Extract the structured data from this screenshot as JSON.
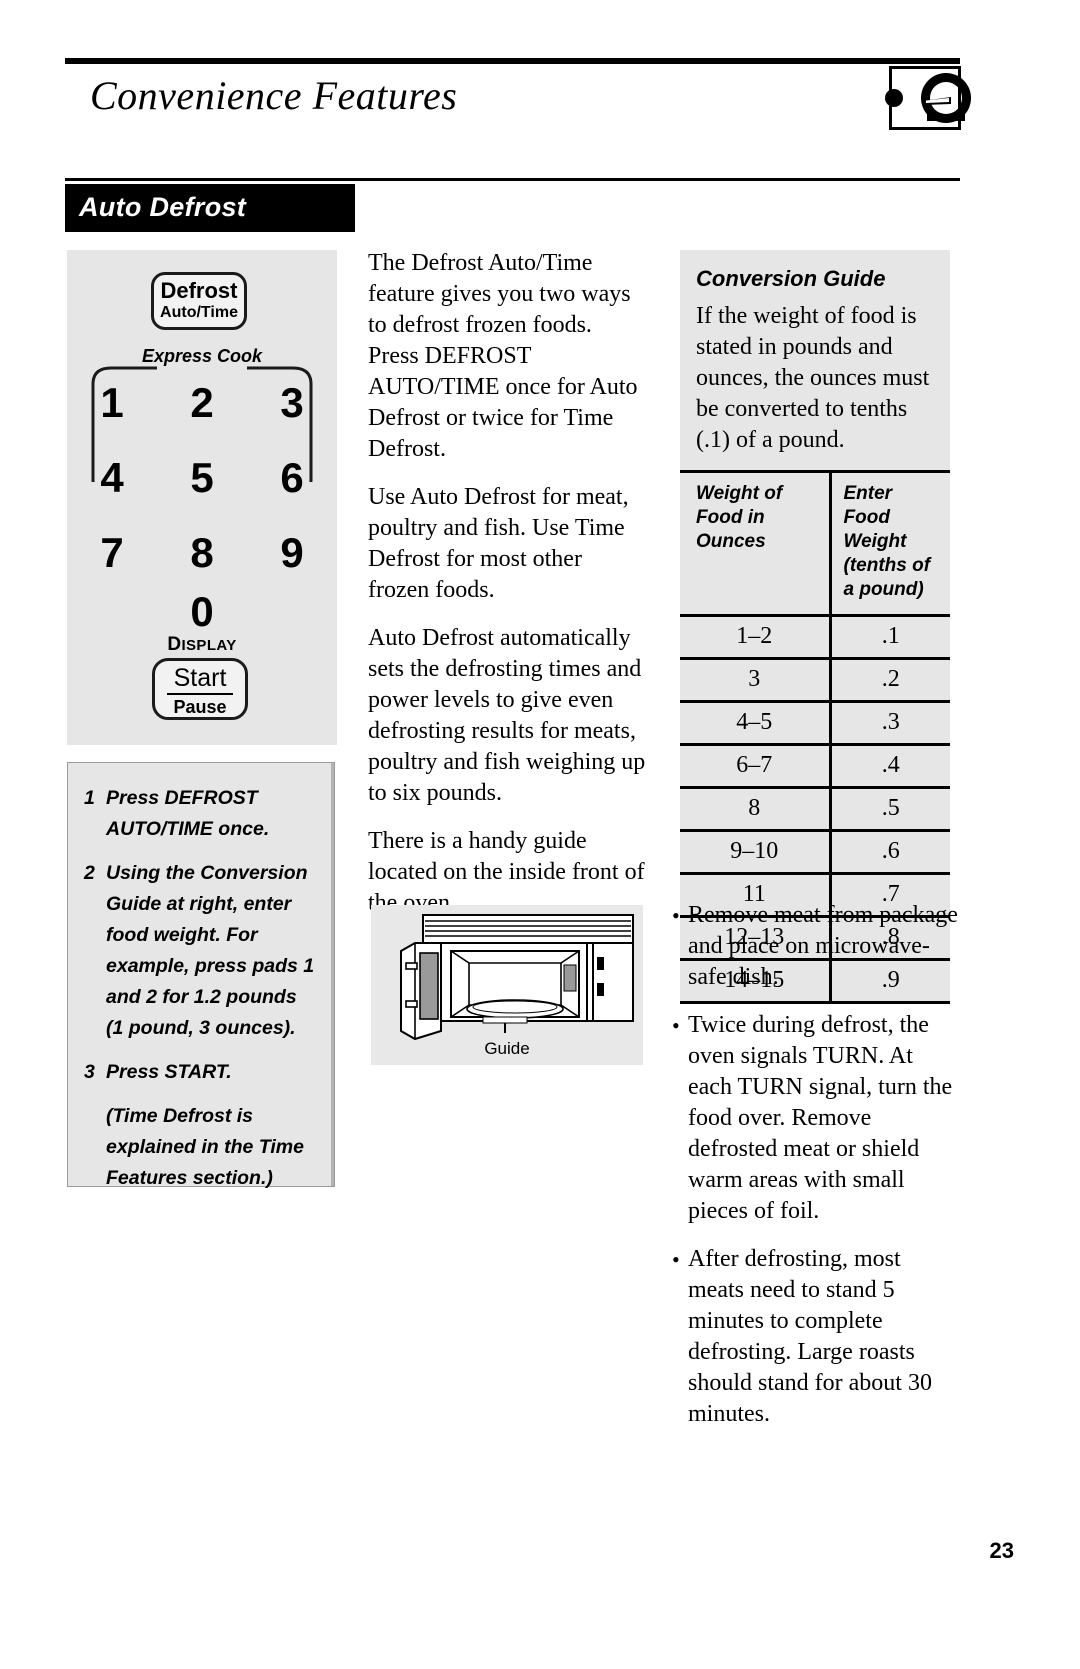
{
  "header": {
    "title": "Convenience Features",
    "icon": "knob-dial-icon"
  },
  "section": {
    "title": "Auto Defrost"
  },
  "control_panel": {
    "defrost_key": {
      "line1": "Defrost",
      "line2": "Auto/Time"
    },
    "express_cook_label": "Express Cook",
    "keys": [
      [
        "1",
        "2",
        "3"
      ],
      [
        "4",
        "5",
        "6"
      ],
      [
        "7",
        "8",
        "9"
      ]
    ],
    "zero_key": "0",
    "display_label_first": "D",
    "display_label_rest": "ISPLAY",
    "start_key": {
      "line1": "Start",
      "line2": "Pause"
    }
  },
  "steps": [
    {
      "num": "1",
      "text": "Press DEFROST AUTO/TIME once."
    },
    {
      "num": "2",
      "text": "Using the Conversion Guide at right, enter food weight. For example, press pads 1 and 2 for 1.2 pounds (1 pound, 3 ounces)."
    },
    {
      "num": "3",
      "text": "Press START."
    },
    {
      "num": "",
      "text": "(Time Defrost is explained in the Time Features section.)"
    }
  ],
  "body_paragraphs": [
    "The Defrost Auto/Time feature gives you two ways to defrost frozen foods. Press DEFROST AUTO/TIME once for Auto Defrost or twice for Time Defrost.",
    "Use Auto Defrost for meat, poultry and fish. Use Time Defrost for most other frozen foods.",
    "Auto Defrost automatically sets the defrosting times and power levels to give even defrosting results for meats, poultry and fish weighing up to six pounds.",
    "There is a handy guide located on the inside front of the oven."
  ],
  "figure": {
    "caption": "Guide",
    "alt": "microwave-oven-with-open-door-illustration"
  },
  "conversion_guide": {
    "title": "Conversion Guide",
    "intro": "If the weight of food is stated in pounds and ounces, the ounces must be converted to tenths (.1) of a pound.",
    "columns": [
      "Weight of Food in Ounces",
      "Enter Food Weight (tenths of a pound)"
    ],
    "rows": [
      {
        "ounces": "1–2",
        "tenths": ".1"
      },
      {
        "ounces": "3",
        "tenths": ".2"
      },
      {
        "ounces": "4–5",
        "tenths": ".3"
      },
      {
        "ounces": "6–7",
        "tenths": ".4"
      },
      {
        "ounces": "8",
        "tenths": ".5"
      },
      {
        "ounces": "9–10",
        "tenths": ".6"
      },
      {
        "ounces": "11",
        "tenths": ".7"
      },
      {
        "ounces": "12–13",
        "tenths": ".8"
      },
      {
        "ounces": "14–15",
        "tenths": ".9"
      }
    ]
  },
  "tips": [
    "Remove meat from package and place on microwave-safe dish.",
    "Twice during defrost, the oven signals TURN. At each TURN signal, turn the food over. Remove defrosted meat or shield warm areas with small pieces of foil.",
    "After defrosting, most meats need to stand 5 minutes to complete defrosting. Large roasts should stand for about 30 minutes."
  ],
  "page_number": "23",
  "colors": {
    "ink": "#000000",
    "panel_gray": "#e6e6e6",
    "figure_gray": "#e8e8e8"
  }
}
